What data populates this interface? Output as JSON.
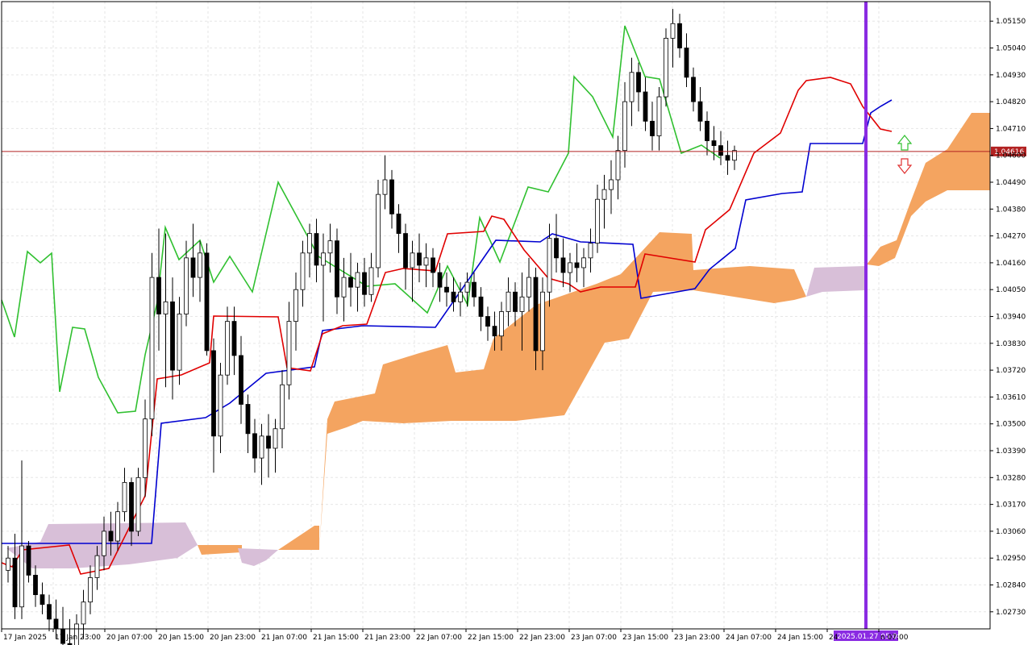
{
  "colors": {
    "background": "#ffffff",
    "grid": "#e6e6e6",
    "axis": "#000000",
    "bull_body": "#ffffff",
    "bear_body": "#000000",
    "candle_outline": "#000000",
    "tenkan": "#e00000",
    "kijun": "#0000d0",
    "chikou": "#30c030",
    "kumo_bull": "#f4a460",
    "kumo_bear": "#d8bfd8",
    "price_line": "#b22222",
    "time_line": "#8a2be2",
    "arrow_up": "#30c030",
    "arrow_down": "#e03030"
  },
  "current_price_label": "1.04616",
  "current_time_label": "2025.01.27 05:00",
  "icons": [
    "arrow-up-icon",
    "arrow-down-icon"
  ],
  "chart_data": {
    "type": "candlestick",
    "title": "",
    "y_ticks": [
      "1.05150",
      "1.05040",
      "1.04930",
      "1.04820",
      "1.04710",
      "1.04600",
      "1.04490",
      "1.04380",
      "1.04270",
      "1.04160",
      "1.04050",
      "1.03940",
      "1.03830",
      "1.03720",
      "1.03610",
      "1.03500",
      "1.03390",
      "1.03280",
      "1.03170",
      "1.03060",
      "1.02950",
      "1.02840",
      "1.02730"
    ],
    "x_ticks": [
      "17 Jan 2025",
      "17 Jan 23:00",
      "20 Jan 07:00",
      "20 Jan 15:00",
      "20 Jan 23:00",
      "21 Jan 07:00",
      "21 Jan 15:00",
      "21 Jan 23:00",
      "22 Jan 07:00",
      "22 Jan 15:00",
      "22 Jan 23:00",
      "23 Jan 07:00",
      "23 Jan 15:00",
      "23 Jan 23:00",
      "24 Jan 07:00",
      "24 Jan 15:00",
      "24",
      "n 07:00"
    ],
    "ylim": [
      1.0266,
      1.0523
    ],
    "current_price": 1.04616,
    "candles": [
      [
        1.029,
        1.03,
        1.0285,
        1.0295
      ],
      [
        1.0295,
        1.0305,
        1.027,
        1.0275
      ],
      [
        1.0275,
        1.0335,
        1.027,
        1.03
      ],
      [
        1.03,
        1.0302,
        1.0285,
        1.0288
      ],
      [
        1.0288,
        1.0292,
        1.0275,
        1.028
      ],
      [
        1.028,
        1.0285,
        1.0272,
        1.0276
      ],
      [
        1.0276,
        1.028,
        1.0265,
        1.027
      ],
      [
        1.027,
        1.0278,
        1.0262,
        1.0266
      ],
      [
        1.0266,
        1.0275,
        1.0256,
        1.026
      ],
      [
        1.026,
        1.027,
        1.025,
        1.0258
      ],
      [
        1.0258,
        1.0272,
        1.0252,
        1.0268
      ],
      [
        1.0268,
        1.0282,
        1.0262,
        1.0277
      ],
      [
        1.0277,
        1.0292,
        1.0272,
        1.0287
      ],
      [
        1.0287,
        1.03,
        1.0282,
        1.0296
      ],
      [
        1.0296,
        1.0312,
        1.029,
        1.0306
      ],
      [
        1.0306,
        1.0314,
        1.0296,
        1.0302
      ],
      [
        1.0302,
        1.0318,
        1.0298,
        1.0314
      ],
      [
        1.0314,
        1.0332,
        1.031,
        1.0326
      ],
      [
        1.0326,
        1.0328,
        1.03,
        1.0306
      ],
      [
        1.0306,
        1.0332,
        1.0304,
        1.0328
      ],
      [
        1.0328,
        1.036,
        1.032,
        1.0352
      ],
      [
        1.0352,
        1.042,
        1.0345,
        1.041
      ],
      [
        1.041,
        1.043,
        1.038,
        1.0395
      ],
      [
        1.0395,
        1.0428,
        1.0365,
        1.04
      ],
      [
        1.04,
        1.041,
        1.036,
        1.0372
      ],
      [
        1.0372,
        1.0402,
        1.0366,
        1.0395
      ],
      [
        1.0395,
        1.0425,
        1.039,
        1.0418
      ],
      [
        1.0418,
        1.0432,
        1.0402,
        1.041
      ],
      [
        1.041,
        1.0425,
        1.04,
        1.042
      ],
      [
        1.042,
        1.0424,
        1.0378,
        1.038
      ],
      [
        1.038,
        1.0385,
        1.033,
        1.0345
      ],
      [
        1.0345,
        1.0375,
        1.0338,
        1.037
      ],
      [
        1.037,
        1.0398,
        1.0366,
        1.0392
      ],
      [
        1.0392,
        1.0398,
        1.037,
        1.0378
      ],
      [
        1.0378,
        1.0386,
        1.035,
        1.0358
      ],
      [
        1.0358,
        1.0362,
        1.0338,
        1.0346
      ],
      [
        1.0346,
        1.0352,
        1.033,
        1.0336
      ],
      [
        1.0336,
        1.035,
        1.0325,
        1.0345
      ],
      [
        1.0345,
        1.0354,
        1.0328,
        1.034
      ],
      [
        1.034,
        1.0352,
        1.033,
        1.0348
      ],
      [
        1.0348,
        1.0372,
        1.034,
        1.0366
      ],
      [
        1.0366,
        1.04,
        1.036,
        1.0392
      ],
      [
        1.0392,
        1.0412,
        1.038,
        1.0405
      ],
      [
        1.0405,
        1.0425,
        1.0398,
        1.042
      ],
      [
        1.042,
        1.0432,
        1.041,
        1.0428
      ],
      [
        1.0428,
        1.0434,
        1.0408,
        1.0415
      ],
      [
        1.0415,
        1.0428,
        1.0392,
        1.042
      ],
      [
        1.042,
        1.0432,
        1.0412,
        1.0425
      ],
      [
        1.0425,
        1.043,
        1.0395,
        1.0402
      ],
      [
        1.0402,
        1.0418,
        1.0392,
        1.041
      ],
      [
        1.041,
        1.042,
        1.0398,
        1.0406
      ],
      [
        1.0406,
        1.0416,
        1.0396,
        1.0412
      ],
      [
        1.0412,
        1.0418,
        1.0398,
        1.0403
      ],
      [
        1.0403,
        1.042,
        1.04,
        1.0414
      ],
      [
        1.0414,
        1.045,
        1.041,
        1.0444
      ],
      [
        1.0444,
        1.046,
        1.0438,
        1.045
      ],
      [
        1.045,
        1.0454,
        1.043,
        1.0436
      ],
      [
        1.0436,
        1.044,
        1.042,
        1.0428
      ],
      [
        1.0428,
        1.0432,
        1.0405,
        1.0414
      ],
      [
        1.0414,
        1.0425,
        1.04,
        1.042
      ],
      [
        1.042,
        1.0428,
        1.0408,
        1.0415
      ],
      [
        1.0415,
        1.0424,
        1.0406,
        1.0418
      ],
      [
        1.0418,
        1.0422,
        1.0406,
        1.0412
      ],
      [
        1.0412,
        1.0416,
        1.04,
        1.0406
      ],
      [
        1.0406,
        1.0412,
        1.0398,
        1.0404
      ],
      [
        1.0404,
        1.041,
        1.0396,
        1.04
      ],
      [
        1.04,
        1.0408,
        1.0394,
        1.0404
      ],
      [
        1.0404,
        1.0412,
        1.0398,
        1.0408
      ],
      [
        1.0408,
        1.0412,
        1.0398,
        1.0402
      ],
      [
        1.0402,
        1.0406,
        1.0388,
        1.0394
      ],
      [
        1.0394,
        1.0398,
        1.0384,
        1.039
      ],
      [
        1.039,
        1.0396,
        1.038,
        1.0386
      ],
      [
        1.0386,
        1.04,
        1.038,
        1.0396
      ],
      [
        1.0396,
        1.041,
        1.039,
        1.0404
      ],
      [
        1.0404,
        1.0408,
        1.039,
        1.0396
      ],
      [
        1.0396,
        1.0412,
        1.038,
        1.0402
      ],
      [
        1.0402,
        1.0418,
        1.0396,
        1.041
      ],
      [
        1.041,
        1.0414,
        1.0372,
        1.038
      ],
      [
        1.038,
        1.041,
        1.0372,
        1.0404
      ],
      [
        1.0404,
        1.0432,
        1.0398,
        1.0426
      ],
      [
        1.0426,
        1.0436,
        1.0412,
        1.0418
      ],
      [
        1.0418,
        1.0426,
        1.0406,
        1.0412
      ],
      [
        1.0412,
        1.042,
        1.0404,
        1.0416
      ],
      [
        1.0416,
        1.0424,
        1.0408,
        1.0414
      ],
      [
        1.0414,
        1.0422,
        1.0406,
        1.0418
      ],
      [
        1.0418,
        1.043,
        1.0412,
        1.0424
      ],
      [
        1.0424,
        1.0448,
        1.042,
        1.0442
      ],
      [
        1.0442,
        1.0452,
        1.043,
        1.0446
      ],
      [
        1.0446,
        1.0458,
        1.0436,
        1.045
      ],
      [
        1.045,
        1.0468,
        1.0442,
        1.0462
      ],
      [
        1.0462,
        1.049,
        1.0455,
        1.0482
      ],
      [
        1.0482,
        1.05,
        1.0472,
        1.0494
      ],
      [
        1.0494,
        1.0498,
        1.0478,
        1.0486
      ],
      [
        1.0486,
        1.0492,
        1.047,
        1.0474
      ],
      [
        1.0474,
        1.0482,
        1.0462,
        1.0468
      ],
      [
        1.0468,
        1.0488,
        1.0462,
        1.0484
      ],
      [
        1.0484,
        1.0512,
        1.048,
        1.0508
      ],
      [
        1.0508,
        1.052,
        1.0496,
        1.0514
      ],
      [
        1.0514,
        1.0518,
        1.05,
        1.0504
      ],
      [
        1.0504,
        1.051,
        1.0488,
        1.0492
      ],
      [
        1.0492,
        1.0496,
        1.0478,
        1.0482
      ],
      [
        1.0482,
        1.0488,
        1.047,
        1.0474
      ],
      [
        1.0474,
        1.0478,
        1.046,
        1.0466
      ],
      [
        1.0466,
        1.0472,
        1.0458,
        1.0464
      ],
      [
        1.0464,
        1.047,
        1.0456,
        1.046
      ],
      [
        1.046,
        1.0466,
        1.0452,
        1.0458
      ],
      [
        1.0458,
        1.0464,
        1.0454,
        1.0462
      ]
    ],
    "tenkan": [
      1.0287,
      1.0287,
      1.0287,
      1.0285,
      1.028,
      1.0278,
      1.0278,
      1.029,
      1.03,
      1.0306,
      1.032,
      1.034,
      1.0355,
      1.0366,
      1.0372,
      1.0372,
      1.0385,
      1.0395,
      1.0392,
      1.0392,
      1.0392,
      1.0388,
      1.037,
      1.037,
      1.0375,
      1.038,
      1.0394,
      1.0398,
      1.04,
      1.0415,
      1.0415,
      1.0415,
      1.0405,
      1.0405,
      1.0402,
      1.0404,
      1.0402,
      1.0397,
      1.0394,
      1.0392,
      1.0396,
      1.04,
      1.0405,
      1.041,
      1.0415,
      1.043,
      1.046,
      1.0475,
      1.048,
      1.0485,
      1.048,
      1.047
    ],
    "kijun": [
      1.0287,
      1.0287,
      1.0287,
      1.0295,
      1.03,
      1.03,
      1.03,
      1.03,
      1.033,
      1.0335,
      1.0335,
      1.034,
      1.035,
      1.036,
      1.037,
      1.038,
      1.039,
      1.04,
      1.04,
      1.04,
      1.04,
      1.0395,
      1.0395,
      1.041,
      1.042,
      1.0425,
      1.0425,
      1.0425,
      1.0425,
      1.042,
      1.041,
      1.04,
      1.04,
      1.0402,
      1.0404,
      1.041,
      1.042,
      1.0432,
      1.044,
      1.0445,
      1.0447,
      1.0447,
      1.045,
      1.0458,
      1.046,
      1.047,
      1.0476,
      1.048,
      1.0482
    ]
  }
}
